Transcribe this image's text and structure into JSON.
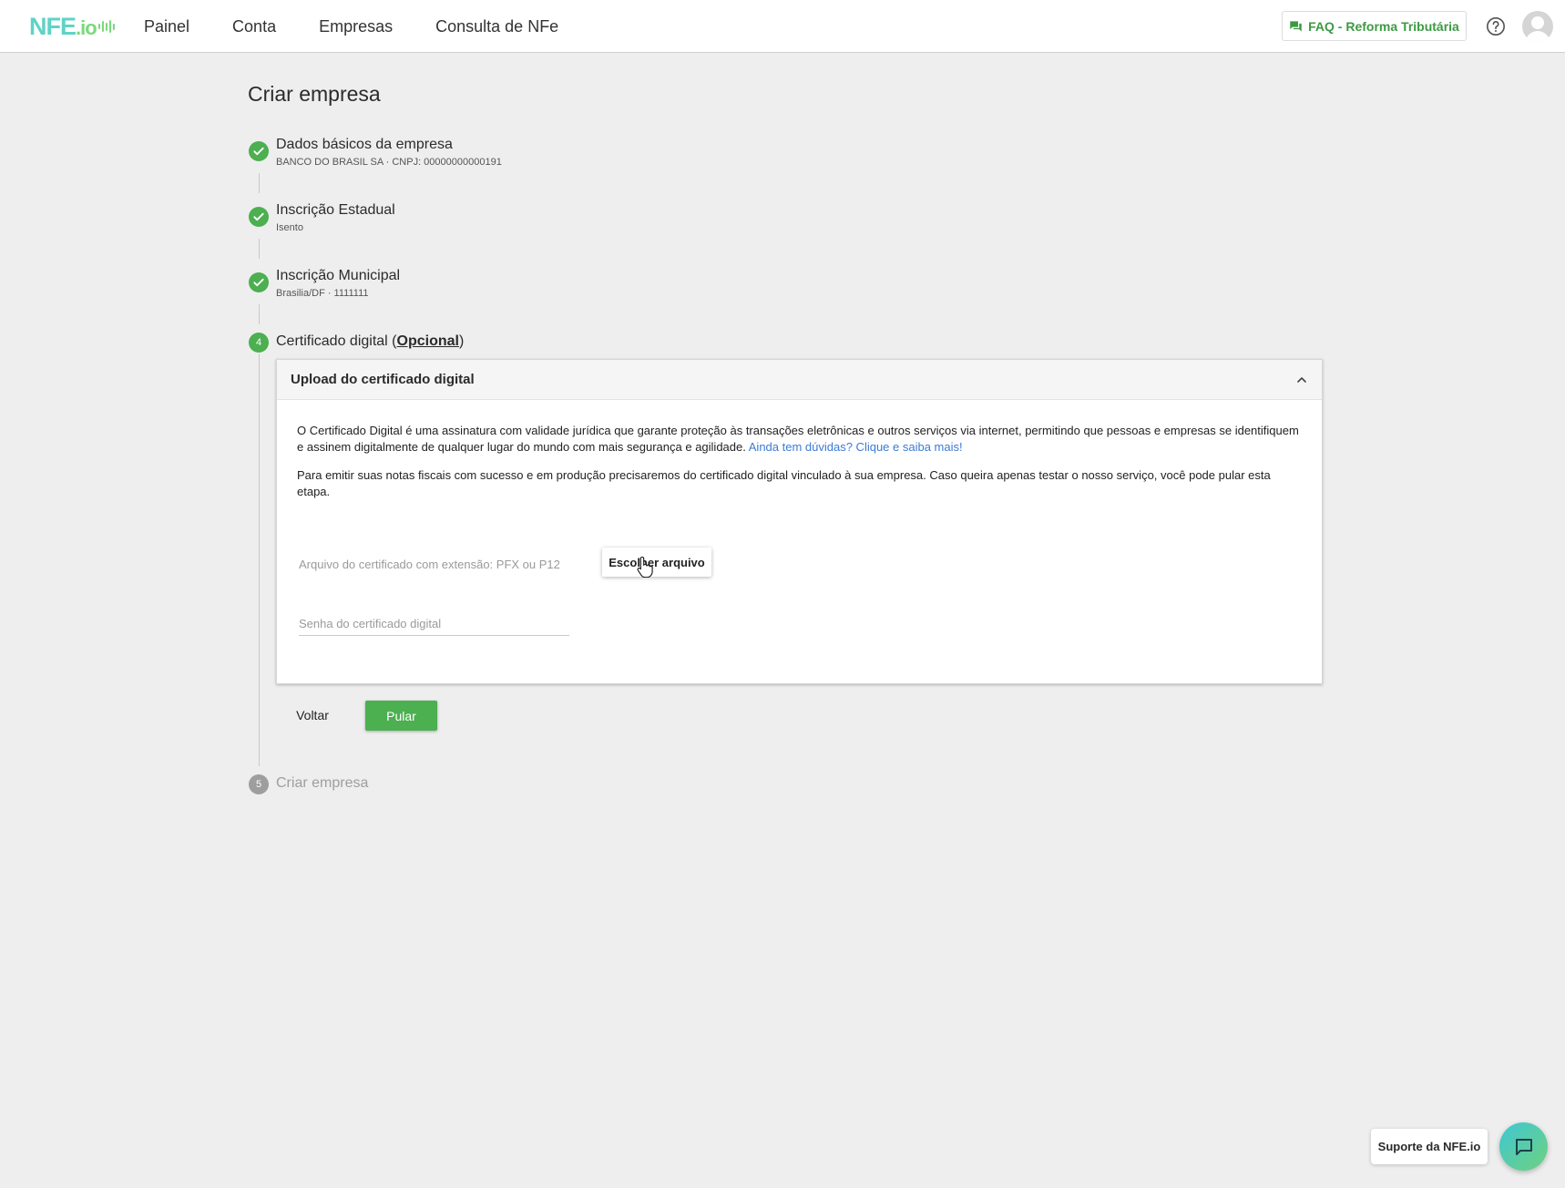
{
  "brand": {
    "logo_text": "NFE",
    "logo_suffix": ".io",
    "primary_color": "#4caf50",
    "logo_color": "#5fd3c7"
  },
  "nav": {
    "items": [
      "Painel",
      "Conta",
      "Empresas",
      "Consulta de NFe"
    ],
    "faq_label": "FAQ - Reforma Tributária",
    "help_icon": "question-circle-icon",
    "avatar_icon": "user-avatar-icon"
  },
  "page": {
    "title": "Criar empresa"
  },
  "steps": [
    {
      "number": "1",
      "status": "done",
      "title": "Dados básicos da empresa",
      "subtitle": "BANCO DO BRASIL SA · CNPJ: 00000000000191"
    },
    {
      "number": "2",
      "status": "done",
      "title": "Inscrição Estadual",
      "subtitle": "Isento"
    },
    {
      "number": "3",
      "status": "done",
      "title": "Inscrição Municipal",
      "subtitle": "Brasilia/DF · 1111111"
    },
    {
      "number": "4",
      "status": "active",
      "title_prefix": "Certificado digital (",
      "title_emphasis": "Opcional",
      "title_suffix": ")"
    },
    {
      "number": "5",
      "status": "pending",
      "title": "Criar empresa"
    }
  ],
  "certificate_card": {
    "header": "Upload do certificado digital",
    "paragraph1": "O Certificado Digital é uma assinatura com validade jurídica que garante proteção às transações eletrônicas e outros serviços via internet, permitindo que pessoas e empresas se identifiquem e assinem digitalmente de qualquer lugar do mundo com mais segurança e agilidade.",
    "paragraph1_link": "Ainda tem dúvidas? Clique e saiba mais!",
    "paragraph2": "Para emitir suas notas fiscais com sucesso e em produção precisaremos do certificado digital vinculado à sua empresa. Caso queira apenas testar o nosso serviço, você pode pular esta etapa.",
    "file_label": "Arquivo do certificado com extensão: PFX ou P12",
    "file_button": "Escolher arquivo",
    "password_placeholder": "Senha do certificado digital",
    "password_value": ""
  },
  "actions": {
    "back_label": "Voltar",
    "skip_label": "Pular"
  },
  "support": {
    "label": "Suporte da NFE.io",
    "icon": "chat-bubble-icon"
  }
}
